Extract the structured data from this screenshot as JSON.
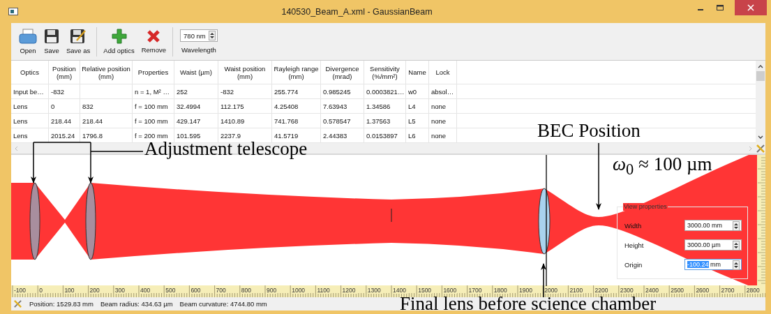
{
  "window": {
    "title": "140530_Beam_A.xml - GaussianBeam"
  },
  "toolbar": {
    "buttons": [
      {
        "label": "Open",
        "kind": "open"
      },
      {
        "label": "Save",
        "kind": "save"
      },
      {
        "label": "Save as",
        "kind": "saveas"
      },
      {
        "label": "Add optics",
        "kind": "add"
      },
      {
        "label": "Remove",
        "kind": "remove"
      }
    ],
    "wavelength": {
      "value": "780 nm",
      "label": "Wavelength"
    }
  },
  "table": {
    "columns": [
      "Optics",
      "Position (mm)",
      "Relative position (mm)",
      "Properties",
      "Waist (µm)",
      "Waist position (mm)",
      "Rayleigh range (mm)",
      "Divergence (mrad)",
      "Sensitivity (%/mm²)",
      "Name",
      "Lock"
    ],
    "rows": [
      [
        "Input be…",
        "-832",
        "",
        "n = 1, M² …",
        "252",
        "-832",
        "255.774",
        "0.985245",
        "0.0003821…",
        "w0",
        "absol…"
      ],
      [
        "Lens",
        "0",
        "832",
        "f = 100 mm",
        "32.4994",
        "112.175",
        "4.25408",
        "7.63943",
        "1.34586",
        "L4",
        "none"
      ],
      [
        "Lens",
        "218.44",
        "218.44",
        "f = 100 mm",
        "429.147",
        "1410.89",
        "741.768",
        "0.578547",
        "1.37563",
        "L5",
        "none"
      ],
      [
        "Lens",
        "2015.24",
        "1796.8",
        "f = 200 mm",
        "101.595",
        "2237.9",
        "41.5719",
        "2.44383",
        "0.0153897",
        "L6",
        "none"
      ]
    ]
  },
  "ruler": [
    "-100",
    "0",
    "100",
    "200",
    "300",
    "400",
    "500",
    "600",
    "700",
    "800",
    "900",
    "1000",
    "1100",
    "1200",
    "1300",
    "1400",
    "1500",
    "1600",
    "1700",
    "1800",
    "1900",
    "2000",
    "2100",
    "2200",
    "2300",
    "2400",
    "2500",
    "2600",
    "2700",
    "2800"
  ],
  "view_properties": {
    "title": "View properties",
    "fields": [
      {
        "label": "Width",
        "value": "3000.00",
        "suffix": "mm",
        "selected": false
      },
      {
        "label": "Height",
        "value": "3000.00",
        "suffix": "µm",
        "selected": false
      },
      {
        "label": "Origin",
        "value": "-100.24",
        "suffix": "mm",
        "selected": true
      }
    ]
  },
  "status_bar": [
    "Position: 1529.83 mm",
    "Beam radius: 434.63 µm",
    "Beam curvature: 4744.80 mm"
  ],
  "annotations": [
    {
      "kind": "telescope",
      "text": "Adjustment telescope"
    },
    {
      "kind": "bec",
      "text": "BEC Position"
    },
    {
      "kind": "waist",
      "text": "*ω*$_{0}$ ≈ 100 µm"
    },
    {
      "kind": "final_lens",
      "text": "Final lens before science chamber"
    }
  ]
}
